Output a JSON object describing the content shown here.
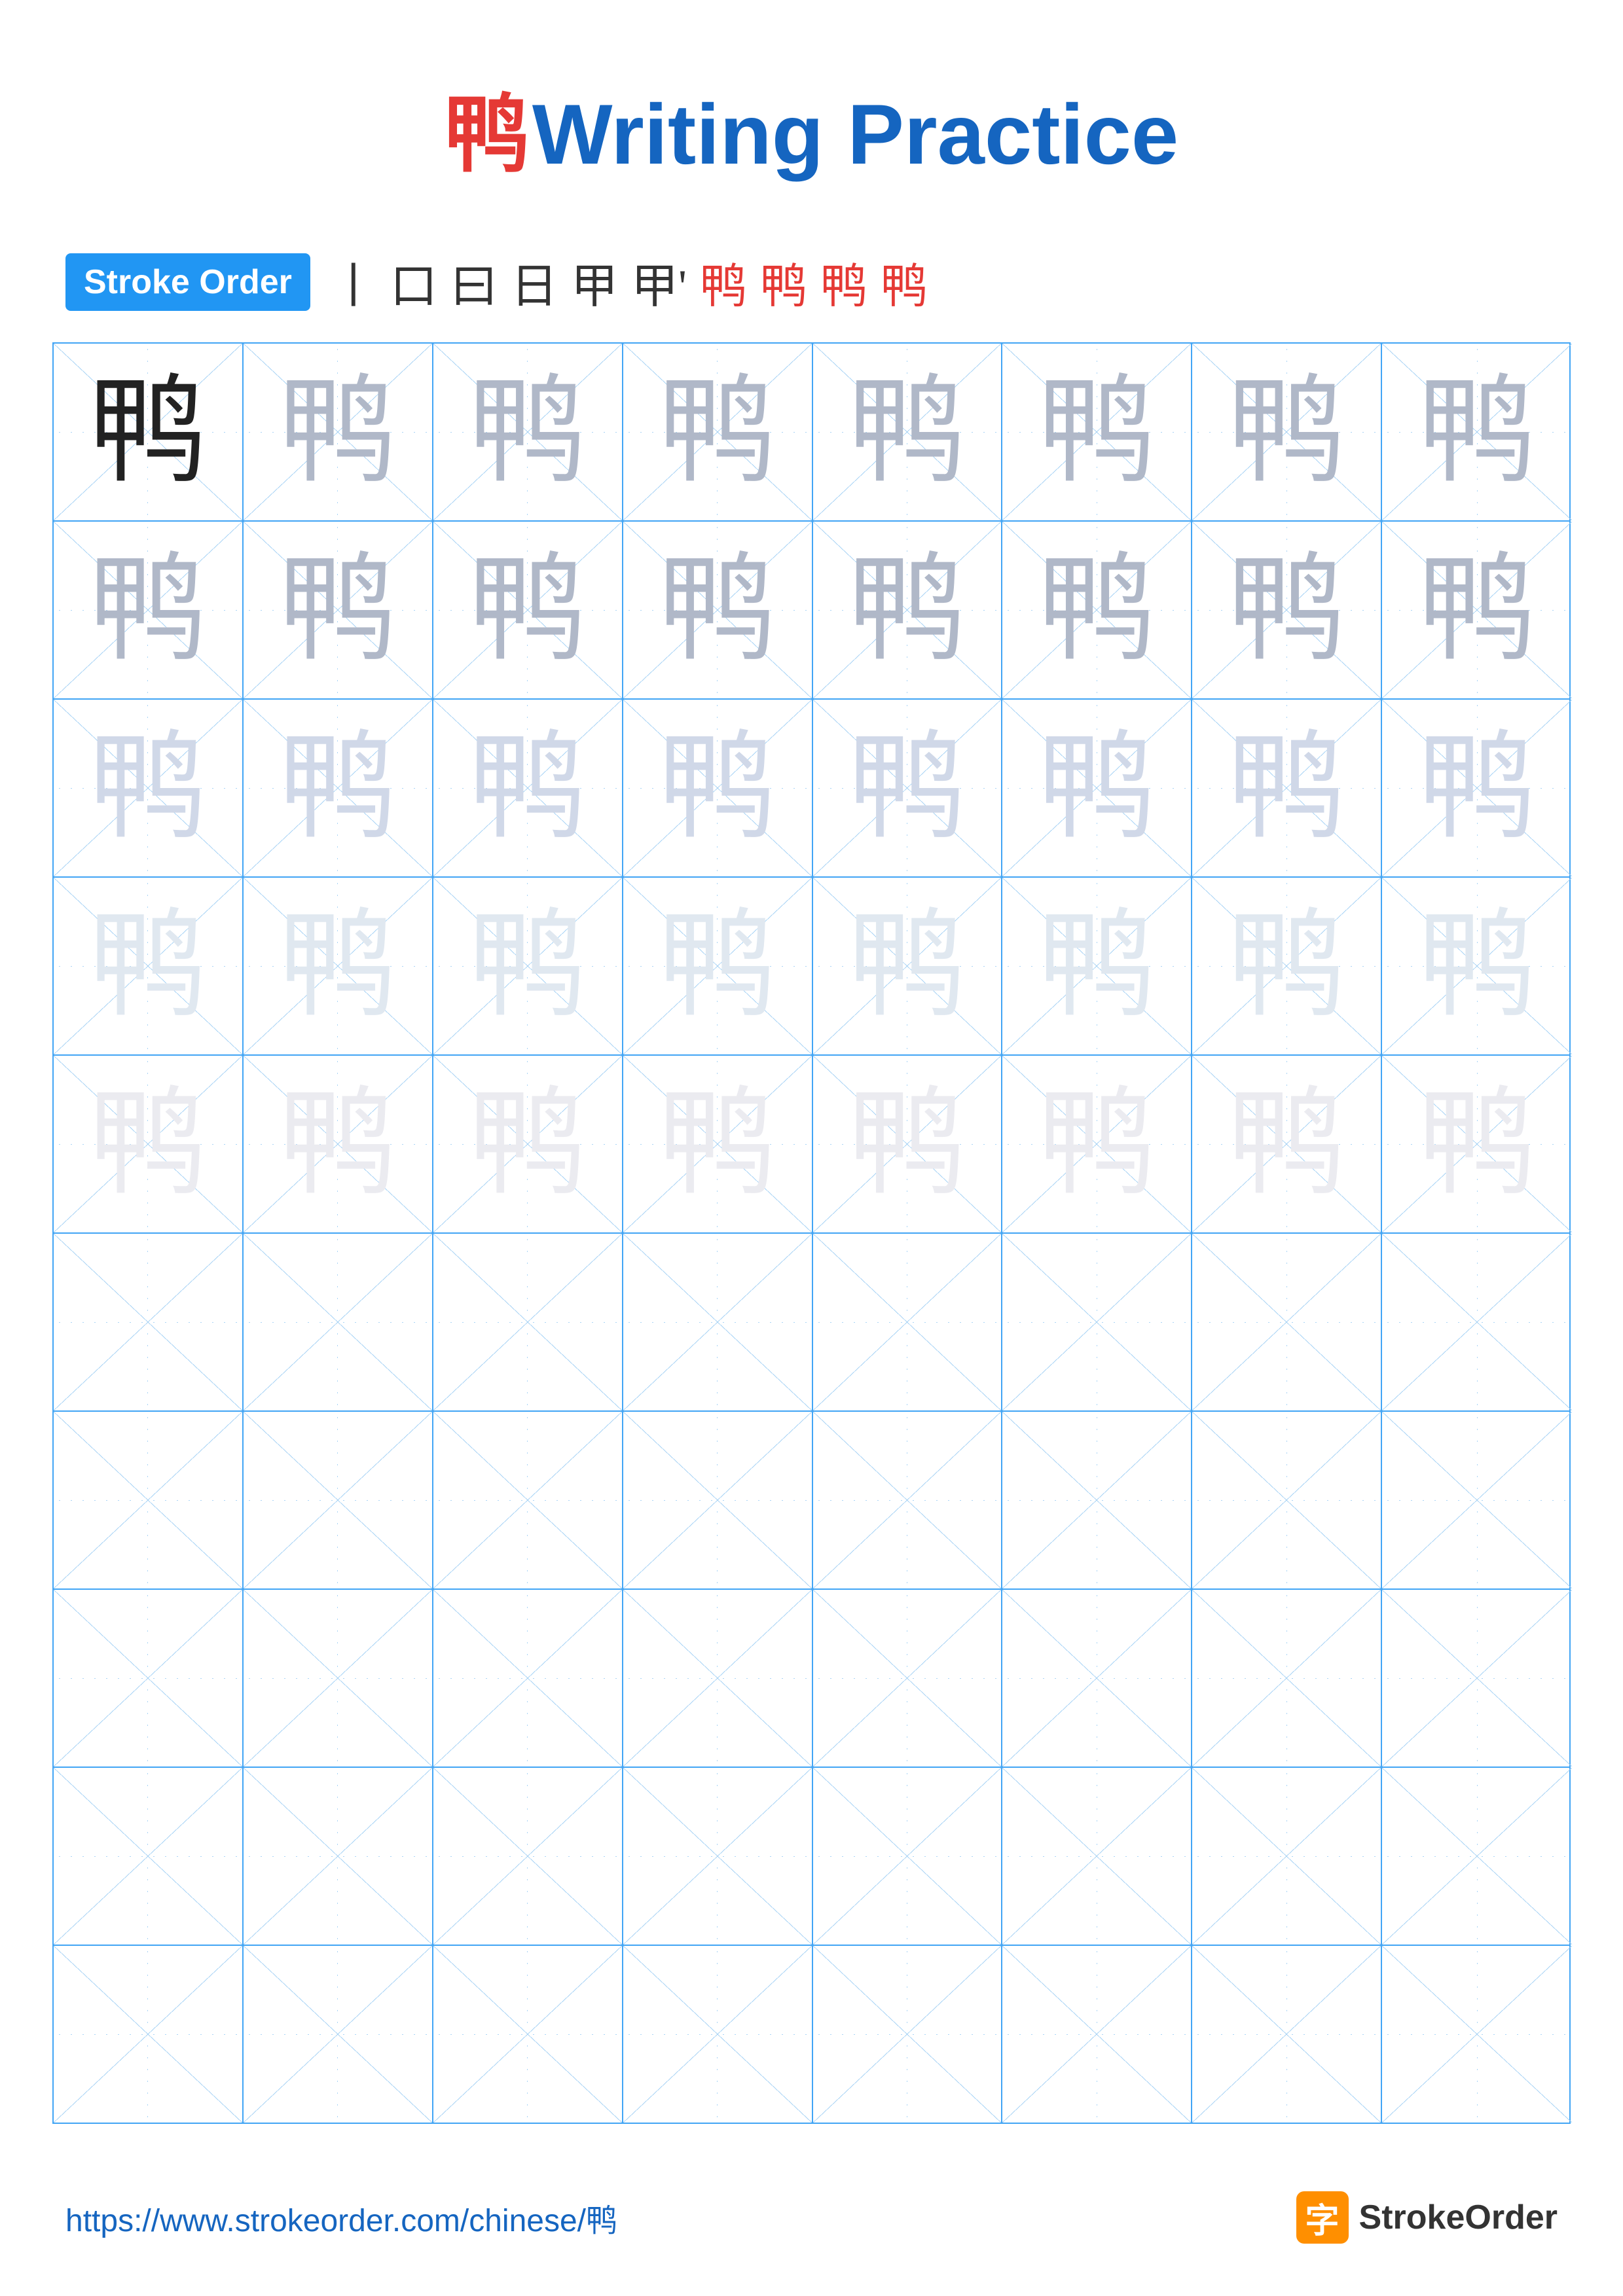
{
  "title": {
    "char": "鸭",
    "text": "Writing Practice"
  },
  "stroke_order": {
    "badge_label": "Stroke Order",
    "strokes": [
      "丨",
      "口",
      "曰",
      "曰",
      "甲",
      "甲'",
      "鸭",
      "鸭",
      "鸭",
      "鸭"
    ]
  },
  "grid": {
    "rows": 10,
    "cols": 8,
    "char": "鸭",
    "trace_rows": 5
  },
  "footer": {
    "url": "https://www.strokeorder.com/chinese/鸭",
    "logo_char": "字",
    "logo_text": "StrokeOrder"
  }
}
